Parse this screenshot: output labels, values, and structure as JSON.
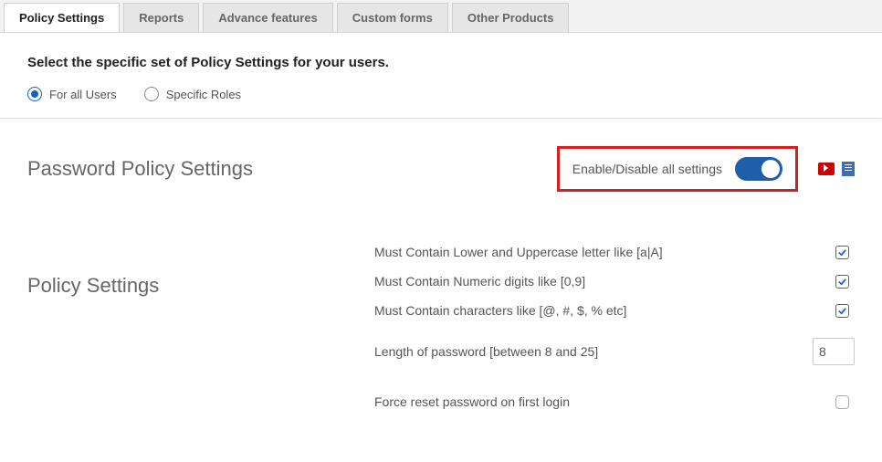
{
  "tabs": {
    "items": [
      {
        "label": "Policy Settings",
        "active": true
      },
      {
        "label": "Reports",
        "active": false
      },
      {
        "label": "Advance features",
        "active": false
      },
      {
        "label": "Custom forms",
        "active": false
      },
      {
        "label": "Other Products",
        "active": false
      }
    ]
  },
  "header": {
    "heading": "Select the specific set of Policy Settings for your users.",
    "radio_all": "For all Users",
    "radio_specific": "Specific Roles"
  },
  "section": {
    "title": "Password Policy Settings",
    "toggle_label": "Enable/Disable all settings",
    "toggle_on": true
  },
  "policy": {
    "subtitle": "Policy Settings",
    "opt_case": "Must Contain Lower and Uppercase letter like [a|A]",
    "opt_numeric": "Must Contain Numeric digits like [0,9]",
    "opt_chars": "Must Contain characters like [@, #, $, % etc]",
    "opt_length": "Length of password [between 8 and 25]",
    "length_value": "8",
    "opt_reset": "Force reset password on first login"
  }
}
